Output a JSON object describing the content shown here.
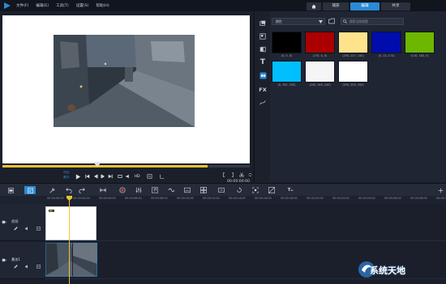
{
  "menu": {
    "items": [
      "文件(F)",
      "编辑(E)",
      "工具(T)",
      "设置(S)",
      "帮助(H)"
    ]
  },
  "workflow_tabs": {
    "home_icon": "home-icon",
    "capture": "捕获",
    "edit": "编辑",
    "share": "共享",
    "active": "编辑"
  },
  "preview": {
    "progress": 0.83,
    "mode_labels": [
      "项目-",
      "素材-"
    ],
    "timecode": "00:00:00:00"
  },
  "library": {
    "category_select": "颜色",
    "search_placeholder": "搜索当前视图",
    "swatches": [
      {
        "label": "(0, 0, 0)",
        "color": "#000000"
      },
      {
        "label": "(170, 0, 0)",
        "color": "#aa0000"
      },
      {
        "label": "(255, 227, 140)",
        "color": "#ffe38c"
      },
      {
        "label": "(0, 13, 172)",
        "color": "#000dac"
      },
      {
        "label": "(110, 183, 0)",
        "color": "#6eb700"
      },
      {
        "label": "(0, 191, 255)",
        "color": "#00bfff"
      },
      {
        "label": "(245, 245, 245)",
        "color": "#f5f5f5"
      },
      {
        "label": "(255, 255, 255)",
        "color": "#ffffff"
      }
    ]
  },
  "timeline": {
    "ruler_labels": [
      "00:00:00:00",
      "00:00:02:00",
      "00:00:04:00",
      "00:00:06:00",
      "00:00:08:00",
      "00:00:10:00",
      "00:00:12:00",
      "00:00:14:00",
      "00:00:16:00",
      "00:00:18:00",
      "00:00:20:00",
      "00:00:22:00",
      "00:00:24:00",
      "00:00:26:00",
      "00:00:28:00",
      "00:00:30:00"
    ],
    "tracks": [
      {
        "name": "视频"
      },
      {
        "name": "叠加1"
      }
    ]
  },
  "watermark": {
    "text": "系统天地"
  },
  "colors": {
    "accent": "#2a8ad6",
    "playhead": "#f2c230"
  }
}
